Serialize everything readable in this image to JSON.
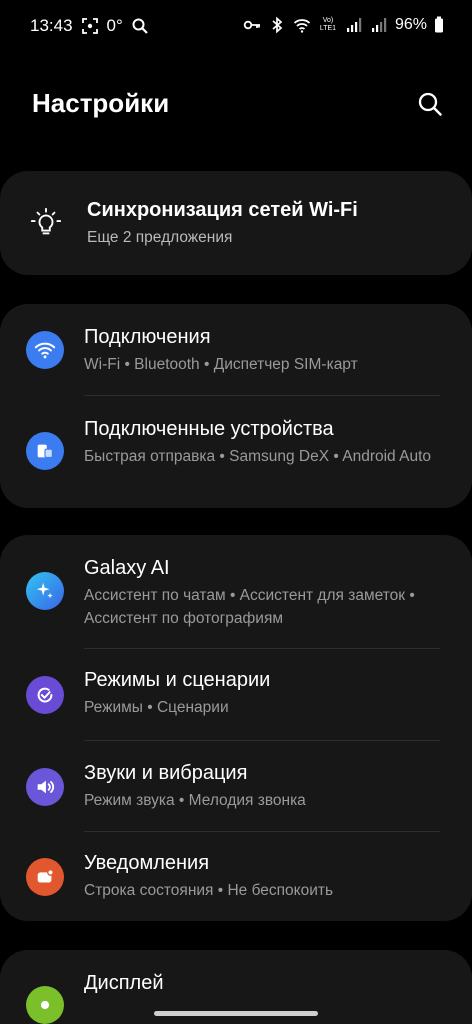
{
  "status_bar": {
    "time": "13:43",
    "temperature": "0°",
    "battery_percent": "96%",
    "volte_label": "Vo) LTE1"
  },
  "header": {
    "title": "Настройки"
  },
  "sync_card": {
    "title": "Синхронизация сетей Wi-Fi",
    "subtitle": "Еще 2 предложения"
  },
  "sections": {
    "connections": {
      "title": "Подключения",
      "subtitle": "Wi-Fi  •  Bluetooth  •  Диспетчер SIM-карт",
      "icon_color": "#3b7cf0"
    },
    "connected_devices": {
      "title": "Подключенные устройства",
      "subtitle": "Быстрая отправка  •  Samsung DeX  •  Android Auto",
      "icon_color": "#3b7cf0"
    },
    "galaxy_ai": {
      "title": "Galaxy AI",
      "subtitle": "Ассистент по чатам  •  Ассистент для заметок  •  Ассистент по фотографиям",
      "icon_color": "#2f8fe8"
    },
    "modes": {
      "title": "Режимы и сценарии",
      "subtitle": "Режимы  •  Сценарии",
      "icon_color": "#6a4bd6"
    },
    "sounds": {
      "title": "Звуки и вибрация",
      "subtitle": "Режим звука  •  Мелодия звонка",
      "icon_color": "#6a56d8"
    },
    "notifications": {
      "title": "Уведомления",
      "subtitle": "Строка состояния  •  Не беспокоить",
      "icon_color": "#e2582e"
    },
    "display": {
      "title": "Дисплей",
      "icon_color": "#7bbf2a"
    }
  }
}
